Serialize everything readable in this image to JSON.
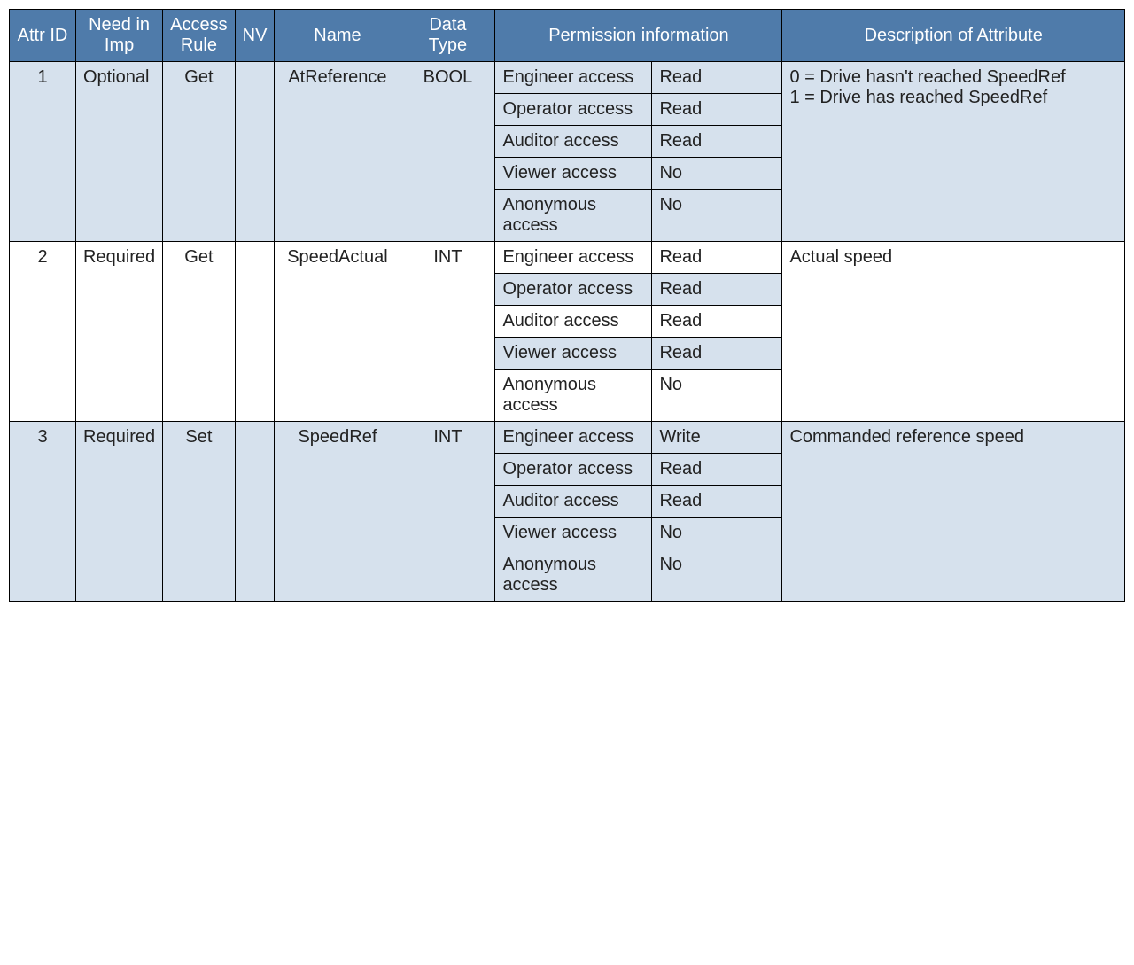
{
  "headers": {
    "attr_id": "Attr ID",
    "need_in_imp": "Need in Imp",
    "access_rule": "Access Rule",
    "nv": "NV",
    "name": "Name",
    "data_type": "Data Type",
    "permission_info": "Permission information",
    "description": "Description of Attribute"
  },
  "rows": [
    {
      "attr_id": "1",
      "need_in_imp": "Optional",
      "access_rule": "Get",
      "nv": "",
      "name": "AtReference",
      "data_type": "BOOL",
      "permissions": [
        {
          "role": "Engineer access",
          "value": "Read"
        },
        {
          "role": "Operator access",
          "value": "Read"
        },
        {
          "role": "Auditor access",
          "value": "Read"
        },
        {
          "role": "Viewer access",
          "value": "No"
        },
        {
          "role": "Anonymous access",
          "value": "No"
        }
      ],
      "description": "0 = Drive hasn't reached SpeedRef\n1 = Drive has reached SpeedRef",
      "base_shaded": true
    },
    {
      "attr_id": "2",
      "need_in_imp": "Required",
      "access_rule": "Get",
      "nv": "",
      "name": "SpeedActual",
      "data_type": "INT",
      "permissions": [
        {
          "role": "Engineer access",
          "value": "Read"
        },
        {
          "role": "Operator access",
          "value": "Read"
        },
        {
          "role": "Auditor access",
          "value": "Read"
        },
        {
          "role": "Viewer access",
          "value": "Read"
        },
        {
          "role": "Anonymous access",
          "value": "No"
        }
      ],
      "description": "Actual speed",
      "base_shaded": false
    },
    {
      "attr_id": "3",
      "need_in_imp": "Required",
      "access_rule": "Set",
      "nv": "",
      "name": "SpeedRef",
      "data_type": "INT",
      "permissions": [
        {
          "role": "Engineer access",
          "value": "Write"
        },
        {
          "role": "Operator access",
          "value": "Read"
        },
        {
          "role": "Auditor access",
          "value": "Read"
        },
        {
          "role": "Viewer access",
          "value": "No"
        },
        {
          "role": "Anonymous access",
          "value": "No"
        }
      ],
      "description": "Commanded reference speed",
      "base_shaded": true
    }
  ]
}
